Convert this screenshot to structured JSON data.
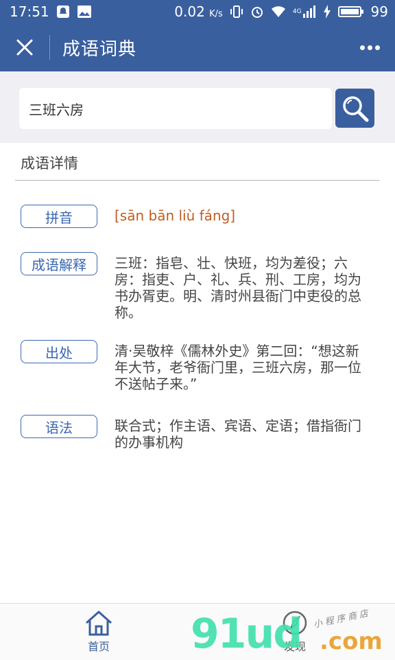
{
  "status_bar": {
    "time": "17:51",
    "net_speed": "0.02",
    "net_unit": "K/s",
    "signal": "4G",
    "battery": "99"
  },
  "nav": {
    "title": "成语词典"
  },
  "search": {
    "value": "三班六房"
  },
  "section": {
    "title": "成语详情"
  },
  "details": [
    {
      "label": "拼音",
      "text": "[sān bān liù fáng]"
    },
    {
      "label": "成语解释",
      "text": "三班：指皂、壮、快班，均为差役；六房：指吏、户、礼、兵、刑、工房，均为书办胥吏。明、清时州县衙门中吏役的总称。"
    },
    {
      "label": "出处",
      "text": "清·吴敬梓《儒林外史》第二回：“想这新年大节，老爷衙门里，三班六房，那一位不送帖子来。”"
    },
    {
      "label": "语法",
      "text": "联合式；作主语、宾语、定语；借指衙门的办事机构"
    }
  ],
  "tabs": [
    {
      "label": "首页"
    },
    {
      "label": "发现"
    }
  ],
  "watermark": {
    "big": "91ud",
    "com": ".com",
    "small": "小程序商店"
  },
  "colors": {
    "brand": "#3a5f9e",
    "tag_border": "#3a68b0",
    "pinyin": "#c15c1e"
  }
}
